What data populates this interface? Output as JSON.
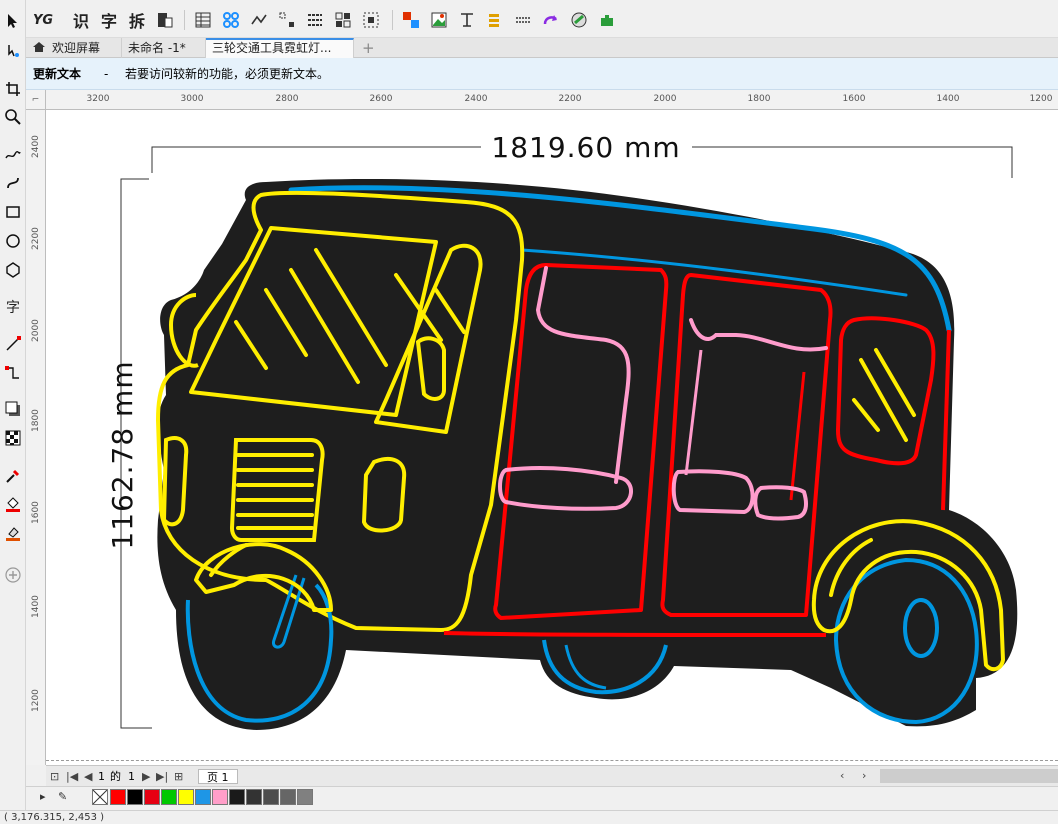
{
  "toolbar": {
    "ocr_label": "识",
    "text_label": "字",
    "split_label": "拆",
    "logo_label": "YG"
  },
  "tabs": [
    {
      "label": "欢迎屏幕"
    },
    {
      "label": "未命名 -1*"
    },
    {
      "label": "三轮交通工具霓虹灯..."
    }
  ],
  "add_tab_label": "+",
  "message": {
    "title": "更新文本",
    "dash": "-",
    "text": "若要访问较新的功能，必须更新文本。"
  },
  "ruler": {
    "h_ticks": [
      "3200",
      "3000",
      "2800",
      "2600",
      "2400",
      "2200",
      "2000",
      "1800",
      "1600",
      "1400",
      "1200"
    ],
    "v_ticks": [
      "2400",
      "2200",
      "2000",
      "1800",
      "1600",
      "1400",
      "1200"
    ]
  },
  "dimensions": {
    "width_label": "1819.60 mm",
    "height_label": "1162.78 mm"
  },
  "pagebar": {
    "current": "1",
    "of_label": "的",
    "total": "1",
    "page_tab": "页 1"
  },
  "palette": {
    "colors": [
      "#ff0000",
      "#000000",
      "#e60012",
      "#00c800",
      "#ffff00",
      "#1e96e6",
      "#ff9ec8",
      "#1a1a1a",
      "#333333",
      "#4d4d4d",
      "#666666",
      "#808080"
    ]
  },
  "status": {
    "coords": "( 3,176.315, 2,453 )"
  },
  "colors": {
    "neon_yellow": "#ffee00",
    "neon_blue": "#0096e0",
    "neon_red": "#ff0000",
    "neon_pink": "#ff9ccc",
    "board": "#1e1e1e",
    "accent": "#3a8ee6"
  }
}
